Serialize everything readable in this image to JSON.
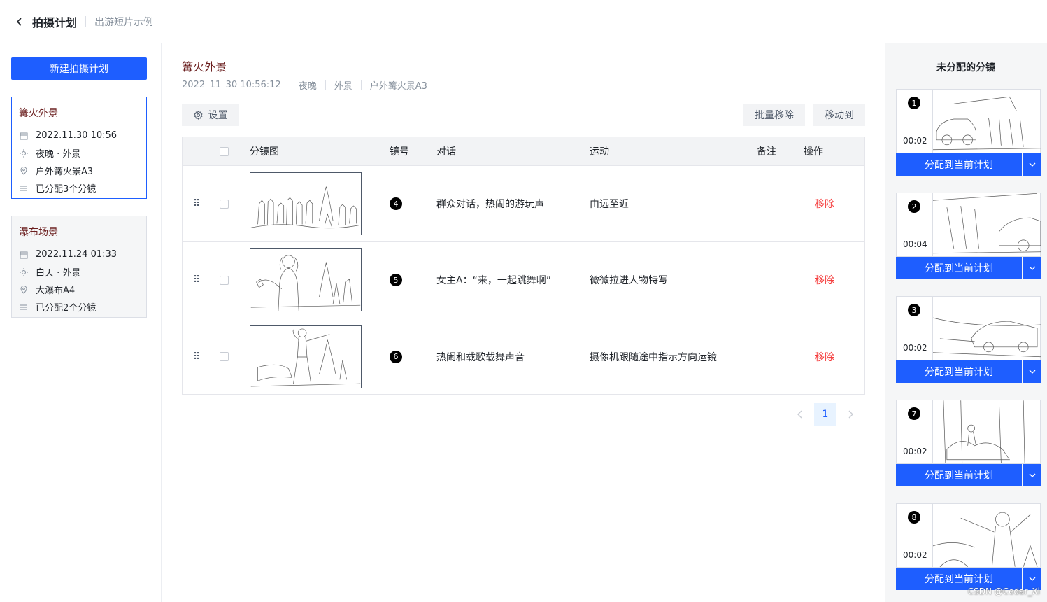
{
  "header": {
    "back_icon": "chevron-left-icon",
    "title": "拍摄计划",
    "subtitle": "出游短片示例"
  },
  "sidebar": {
    "new_button": "新建拍摄计划",
    "plans": [
      {
        "title": "篝火外景",
        "datetime": "2022.11.30 10:56",
        "time_scene": "夜晚 · 外景",
        "location": "户外篝火景A3",
        "assigned": "已分配3个分镜",
        "active": true
      },
      {
        "title": "瀑布场景",
        "datetime": "2022.11.24 01:33",
        "time_scene": "白天 · 外景",
        "location": "大瀑布A4",
        "assigned": "已分配2个分镜",
        "active": false
      }
    ]
  },
  "main": {
    "title": "篝火外景",
    "meta": [
      "2022–11–30 10:56:12",
      "夜晚",
      "外景",
      "户外篝火景A3"
    ],
    "settings_button": "设置",
    "batch_remove_button": "批量移除",
    "move_to_button": "移动到",
    "table": {
      "headers": {
        "storyboard": "分镜图",
        "shot_no": "镜号",
        "dialogue": "对话",
        "motion": "运动",
        "notes": "备注",
        "action": "操作"
      },
      "rows": [
        {
          "shot": "4",
          "dialogue": "群众对话，热闹的游玩声",
          "motion": "由远至近",
          "notes": "",
          "action": "移除"
        },
        {
          "shot": "5",
          "dialogue": "女主A：“来，一起跳舞啊”",
          "motion": "微微拉进人物特写",
          "notes": "",
          "action": "移除"
        },
        {
          "shot": "6",
          "dialogue": "热闹和载歌载舞声音",
          "motion": "摄像机跟随途中指示方向运镜",
          "notes": "",
          "action": "移除"
        }
      ]
    },
    "pagination": {
      "current": "1"
    }
  },
  "unassigned": {
    "title": "未分配的分镜",
    "assign_label": "分配到当前计划",
    "cards": [
      {
        "num": "1",
        "duration": "00:02"
      },
      {
        "num": "2",
        "duration": "00:04"
      },
      {
        "num": "3",
        "duration": "00:02"
      },
      {
        "num": "7",
        "duration": "00:02"
      },
      {
        "num": "8",
        "duration": "00:02"
      }
    ]
  },
  "watermark": "CSDN @Cedar_Xi",
  "colors": {
    "primary": "#1e5eff",
    "danger": "#f53f3f",
    "scene_title": "#6b1f1f",
    "panel_bg": "#f5f6f7"
  }
}
